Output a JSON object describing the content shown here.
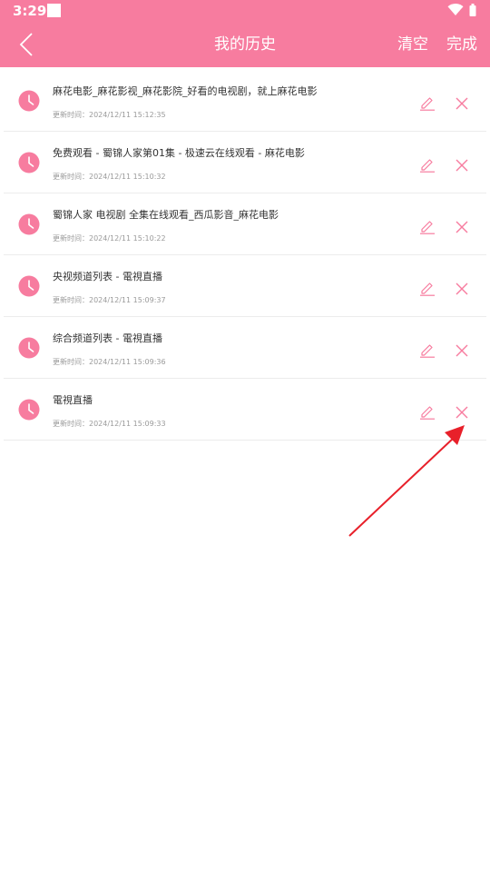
{
  "status_bar": {
    "time": "3:29"
  },
  "header": {
    "title": "我的历史",
    "clear_label": "清空",
    "done_label": "完成",
    "background_color": "#f77c9f"
  },
  "history": {
    "time_prefix": "更新时间：",
    "items": [
      {
        "title": "麻花电影_麻花影视_麻花影院_好看的电视剧，就上麻花电影",
        "time": "2024/12/11 15:12:35"
      },
      {
        "title": "免费观看 - 蜀锦人家第01集 - 极速云在线观看 - 麻花电影",
        "time": "2024/12/11 15:10:32"
      },
      {
        "title": "蜀锦人家 电视剧 全集在线观看_西瓜影音_麻花电影",
        "time": "2024/12/11 15:10:22"
      },
      {
        "title": "央视频道列表 - 電視直播",
        "time": "2024/12/11 15:09:37"
      },
      {
        "title": "综合频道列表 - 電視直播",
        "time": "2024/12/11 15:09:36"
      },
      {
        "title": "電視直播",
        "time": "2024/12/11 15:09:33"
      }
    ]
  },
  "icons": {
    "history": "clock-icon",
    "edit": "pencil-icon",
    "delete": "close-icon",
    "back": "chevron-left-icon"
  },
  "colors": {
    "accent": "#f77c9f",
    "annotation": "#e8202a"
  }
}
